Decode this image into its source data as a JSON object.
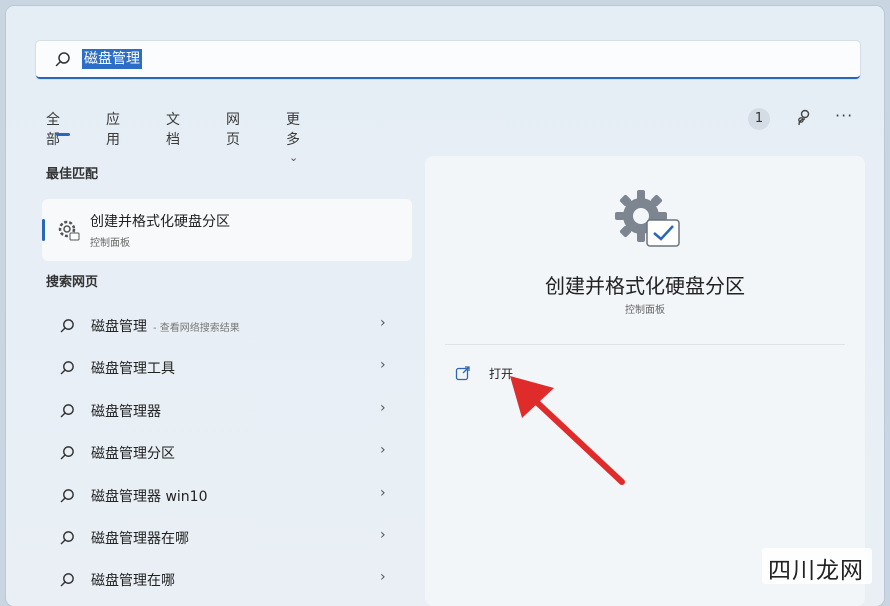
{
  "search": {
    "query": "磁盘管理"
  },
  "tabs": [
    "全部",
    "应用",
    "文档",
    "网页",
    "更多"
  ],
  "header": {
    "result_count": "1"
  },
  "best_match": {
    "section_title": "最佳匹配",
    "title": "创建并格式化硬盘分区",
    "subtitle": "控制面板"
  },
  "web_search": {
    "section_title": "搜索网页",
    "items": [
      {
        "label": "磁盘管理",
        "sub": "- 查看网络搜索结果"
      },
      {
        "label": "磁盘管理工具"
      },
      {
        "label": "磁盘管理器"
      },
      {
        "label": "磁盘管理分区"
      },
      {
        "label": "磁盘管理器 win10"
      },
      {
        "label": "磁盘管理器在哪"
      },
      {
        "label": "磁盘管理在哪"
      }
    ]
  },
  "detail": {
    "title": "创建并格式化硬盘分区",
    "subtitle": "控制面板",
    "action_open": "打开"
  },
  "watermark": "四川龙网",
  "colors": {
    "accent": "#2a67b8",
    "arrow": "#e02b2b"
  }
}
